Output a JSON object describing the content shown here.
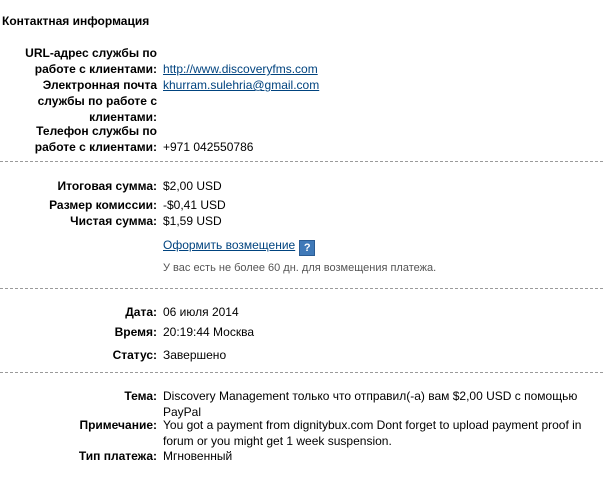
{
  "section_title": "Контактная информация",
  "contact": {
    "url_label": "URL-адрес службы по работе с клиентами:",
    "url_value": "http://www.discoveryfms.com",
    "email_label": "Электронная почта службы по работе с клиентами:",
    "email_value": "khurram.sulehria@gmail.com",
    "phone_label": "Телефон службы по работе с клиентами:",
    "phone_value": "+971 042550786"
  },
  "amounts": {
    "total_label": "Итоговая сумма:",
    "total_value": "$2,00 USD",
    "fee_label": "Размер комиссии:",
    "fee_value": "-$0,41 USD",
    "net_label": "Чистая сумма:",
    "net_value": "$1,59 USD",
    "refund_link": "Оформить возмещение",
    "help_glyph": "?",
    "refund_note": "У вас есть не более 60 дн. для возмещения платежа."
  },
  "details": {
    "date_label": "Дата:",
    "date_value": "06 июля 2014",
    "time_label": "Время:",
    "time_value": "20:19:44 Москва",
    "status_label": "Статус:",
    "status_value": "Завершено"
  },
  "message": {
    "subject_label": "Тема:",
    "subject_value": "Discovery Management только что отправил(-а) вам $2,00 USD с помощью PayPal",
    "note_label": "Примечание:",
    "note_value": "You got a payment from dignitybux.com Dont forget to upload payment proof in forum or you might get 1 week suspension.",
    "type_label": "Тип платежа:",
    "type_value": "Мгновенный"
  },
  "colors": {
    "link": "#00437f",
    "help_icon_bg": "#3f79b8",
    "divider": "#9a9a9a",
    "note_text": "#555555"
  }
}
